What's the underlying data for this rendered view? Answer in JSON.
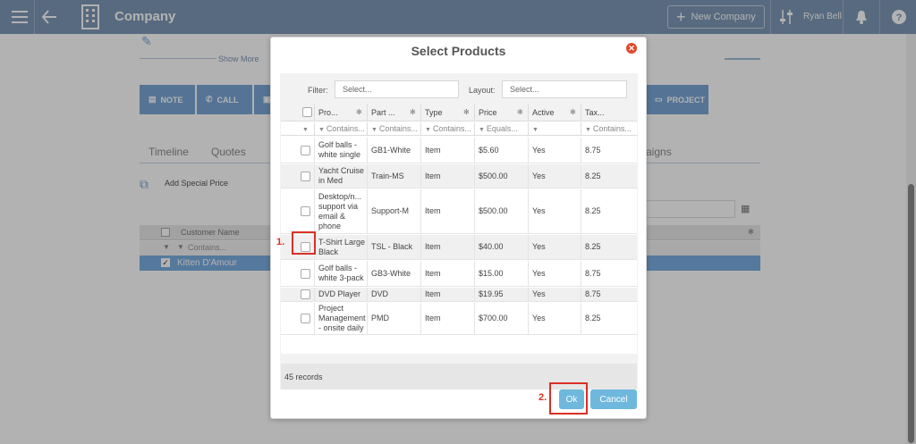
{
  "topbar": {
    "title": "Company",
    "new_button": "New Company",
    "user": "Ryan Bell"
  },
  "background": {
    "show_more": "Show More",
    "actions": [
      "NOTE",
      "CALL",
      "PROJECT"
    ],
    "tabs": [
      "Timeline",
      "Quotes",
      "aigns"
    ],
    "add_special_price": "Add Special Price",
    "customer_col": "Customer Name",
    "customer_filter": "Contains...",
    "customer_row": "Kitten D'Amour"
  },
  "modal": {
    "title": "Select Products",
    "filter_label": "Filter:",
    "filter_placeholder": "Select...",
    "layout_label": "Layout:",
    "layout_placeholder": "Select...",
    "columns": [
      "Pro...",
      "Part ...",
      "Type",
      "Price",
      "Active",
      "Tax..."
    ],
    "filters": [
      "Contains...",
      "Contains...",
      "Contains...",
      "Equals...",
      "",
      "Contains..."
    ],
    "rows": [
      {
        "product": [
          "Golf balls -",
          "white single"
        ],
        "part": "GB1-White",
        "type": "Item",
        "price": "$5.60",
        "active": "Yes",
        "tax": "8.75"
      },
      {
        "product": [
          "Yacht Cruise",
          "in Med"
        ],
        "part": "Train-MS",
        "type": "Item",
        "price": "$500.00",
        "active": "Yes",
        "tax": "8.25"
      },
      {
        "product": [
          "Desktop/n...",
          "support via",
          "email &",
          "phone"
        ],
        "part": "Support-M",
        "type": "Item",
        "price": "$500.00",
        "active": "Yes",
        "tax": "8.25"
      },
      {
        "product": [
          "T-Shirt Large",
          "Black"
        ],
        "part": "TSL - Black",
        "type": "Item",
        "price": "$40.00",
        "active": "Yes",
        "tax": "8.25"
      },
      {
        "product": [
          "Golf balls -",
          "white 3-pack"
        ],
        "part": "GB3-White",
        "type": "Item",
        "price": "$15.00",
        "active": "Yes",
        "tax": "8.75"
      },
      {
        "product": [
          "DVD Player"
        ],
        "part": "DVD",
        "type": "Item",
        "price": "$19.95",
        "active": "Yes",
        "tax": "8.75"
      },
      {
        "product": [
          "Project",
          "Management",
          "- onsite daily"
        ],
        "part": "PMD",
        "type": "Item",
        "price": "$700.00",
        "active": "Yes",
        "tax": "8.25"
      }
    ],
    "records": "45 records",
    "ok": "Ok",
    "cancel": "Cancel"
  },
  "annotations": {
    "step1": "1.",
    "step2": "2."
  }
}
